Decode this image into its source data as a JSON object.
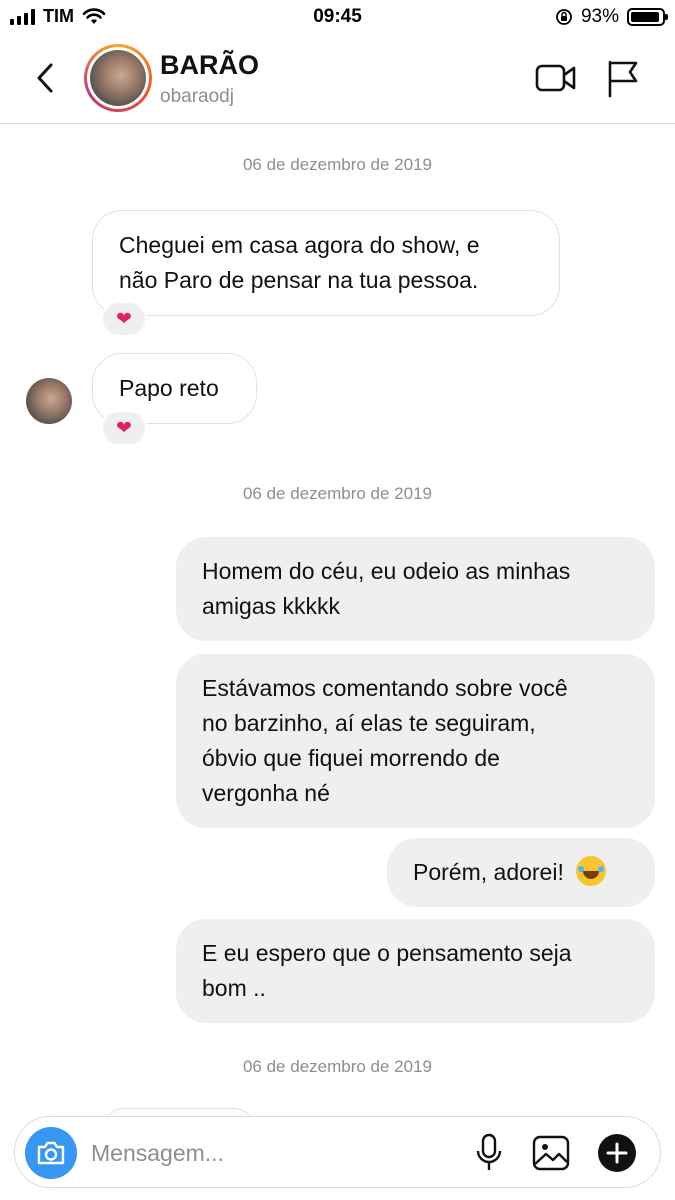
{
  "status_bar": {
    "carrier": "TIM",
    "time": "09:45",
    "battery": "93%",
    "battery_level": 0.93
  },
  "header": {
    "name": "BARÃO",
    "username": "obaraodj"
  },
  "messages": {
    "date_1": "06 de dezembro de 2019",
    "in_1": "Cheguei em casa agora do show, e",
    "in_1b": "não Paro de pensar na tua pessoa.",
    "in_2": "Papo reto",
    "reaction": "❤",
    "date_2": "06 de dezembro de 2019",
    "out_1a": "Homem do céu, eu odeio as minhas",
    "out_1b": "amigas kkkkk",
    "out_2a": "Estávamos comentando sobre você",
    "out_2b": "no barzinho, aí elas te seguiram,",
    "out_2c": "óbvio que fiquei morrendo de",
    "out_2d": "vergonha né",
    "out_3": "Porém, adorei!",
    "out_4a": "E eu espero que o pensamento seja",
    "out_4b": "bom ..",
    "date_3": "06 de dezembro de 2019"
  },
  "composer": {
    "placeholder": "Mensagem..."
  },
  "icons": [
    "back-icon",
    "video-call-icon",
    "flag-icon",
    "camera-icon",
    "microphone-icon",
    "gallery-icon",
    "plus-icon",
    "wifi-icon",
    "signal-icon",
    "battery-icon",
    "orientation-lock-icon"
  ],
  "colors": {
    "accent": "#3897f0",
    "heart": "#e0245e",
    "bubble_out": "#efefef"
  }
}
